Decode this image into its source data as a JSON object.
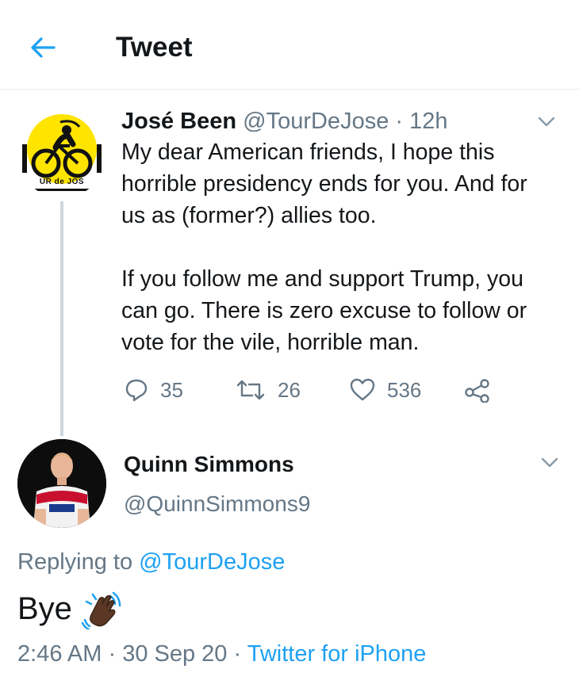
{
  "header": {
    "title": "Tweet",
    "back_icon": "arrow-left-icon",
    "accent": "#1da1f2"
  },
  "parent_tweet": {
    "name": "José Been",
    "handle": "@TourDeJose",
    "time": "12h",
    "avatar_text": "UR de JOS",
    "paragraphs": [
      "My dear American friends, I hope this\nhorrible presidency ends for you. And for\nus as (former?) allies too.",
      "If you follow me and support Trump, you\ncan go. There is zero excuse to follow or\nvote for the vile, horrible man."
    ],
    "stats": {
      "replies": "35",
      "retweets": "26",
      "likes": "536"
    },
    "icons": [
      "reply-icon",
      "retweet-icon",
      "like-icon",
      "share-icon",
      "chevron-down-icon"
    ]
  },
  "reply_tweet": {
    "name": "Quinn Simmons",
    "handle": "@QuinnSimmons9",
    "replying_prefix": "Replying to",
    "replying_mention": "@TourDeJose",
    "text": "Bye",
    "emoji": "waving-hand-dark-skin-tone",
    "time": "2:46 AM",
    "date": "30 Sep 20",
    "separator": "·",
    "source": "Twitter for iPhone"
  },
  "colors": {
    "text": "#14171a",
    "secondary": "#657786",
    "link": "#1da1f2",
    "divider": "#e6ecf0",
    "thread": "#ccd6dd"
  }
}
